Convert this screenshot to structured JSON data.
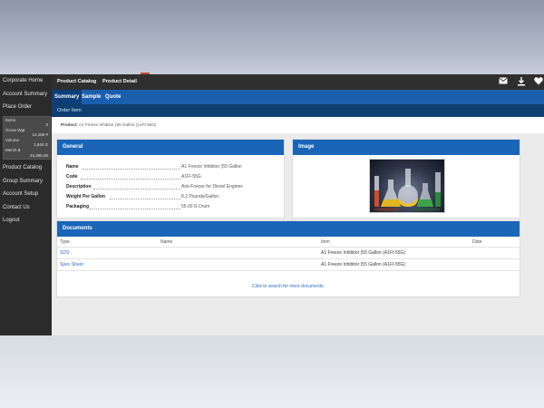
{
  "sidebar": {
    "items_top": [
      "Corporate Home",
      "Account Summary",
      "Place Order"
    ],
    "stats": {
      "items_label": "Items",
      "items_value": "3",
      "gross_weight_label": "Gross Wgt",
      "gross_weight_value": "14,156 #",
      "volume_label": "Volume",
      "volume_value": "1,840 G",
      "merch_label": "Merch $",
      "merch_value": "34,255.00"
    },
    "items_bottom": [
      "Product Catalog",
      "Group Summary",
      "Account Setup",
      "Contact Us",
      "Logout"
    ]
  },
  "header": {
    "breadcrumbs": [
      "Product Catalog",
      "Product Detail"
    ],
    "icons": [
      "mail-icon",
      "download-icon",
      "heart-icon"
    ]
  },
  "tabs": [
    "Summary",
    "Sample",
    "Quote"
  ],
  "active_tab": "Summary",
  "subbar": {
    "label": "Order Item"
  },
  "product": {
    "label": "Product:",
    "value": "A1 Freeze Inhibitor (55 Gallon (A1FI-55G)"
  },
  "general": {
    "title": "General",
    "rows": [
      {
        "label": "Name",
        "value": "A1 Freeze Inhibitor (55 Gallon"
      },
      {
        "label": "Code",
        "value": "A1FI-55G"
      },
      {
        "label": "Description",
        "value": "Anti-Freeze for Diesel Engines"
      },
      {
        "label": "Weight Per Gallon",
        "value": "8.2 Pounds/Gallon"
      },
      {
        "label": "Packaging",
        "value": "55.00 G Drum"
      }
    ]
  },
  "image_panel": {
    "title": "Image"
  },
  "documents": {
    "title": "Documents",
    "columns": [
      "Type",
      "Name",
      "Item",
      "Date"
    ],
    "rows": [
      {
        "type": "SDS",
        "name": "",
        "item": "A1 Freeze Inhibitor (55 Gallon (A1FI-55G)",
        "date": ""
      },
      {
        "type": "Spec Sheet",
        "name": "",
        "item": "A1 Freeze Inhibitor (55 Gallon (A1FI-55G)",
        "date": ""
      }
    ],
    "more_link": "Click to search for more documents."
  },
  "colors": {
    "sidebar_bg": "#2b2b2b",
    "tab_bar": "#1a5fae",
    "panel_header": "#1a65b7",
    "link": "#2a6ec5"
  }
}
